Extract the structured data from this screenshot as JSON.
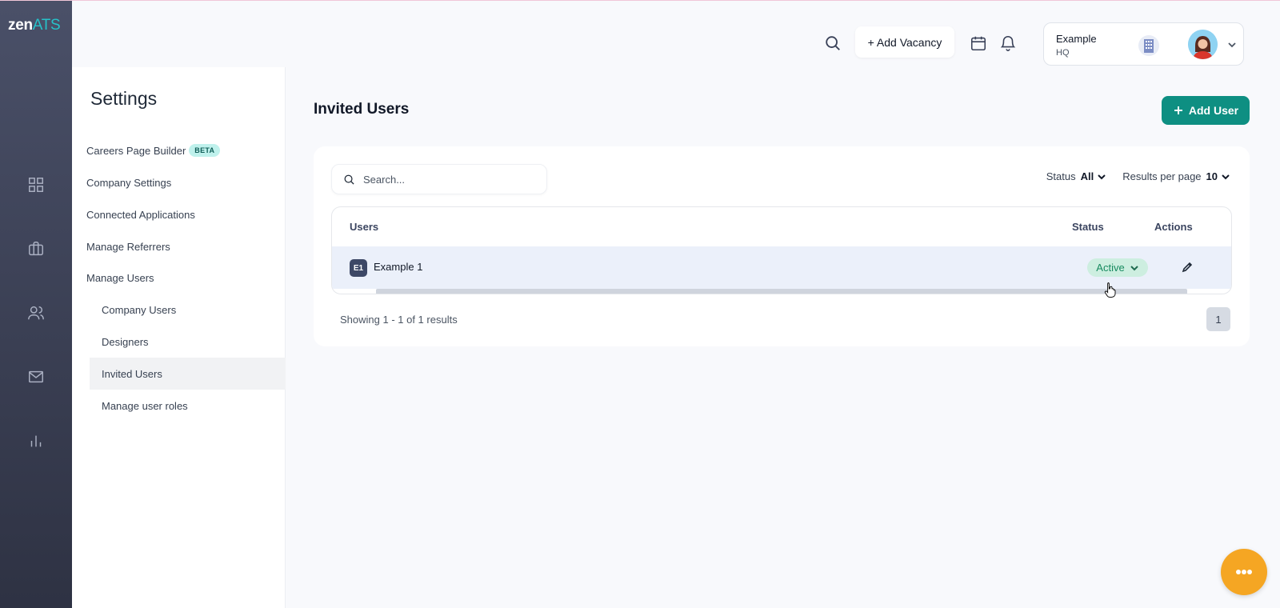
{
  "brand": {
    "logo_zen": "zen",
    "logo_ats": "ATS"
  },
  "rail": {
    "icons": [
      "dashboard-icon",
      "briefcase-icon",
      "people-icon",
      "mail-icon",
      "bar-chart-icon"
    ]
  },
  "topbar": {
    "add_vacancy_label": "+ Add Vacancy",
    "account": {
      "name": "Example",
      "sub": "HQ"
    }
  },
  "settings": {
    "title": "Settings",
    "nav": [
      {
        "label": "Careers Page Builder",
        "badge": "BETA"
      },
      {
        "label": "Company Settings"
      },
      {
        "label": "Connected Applications"
      },
      {
        "label": "Manage Referrers"
      },
      {
        "label": "Manage Users"
      }
    ],
    "subnav": [
      {
        "label": "Company Users"
      },
      {
        "label": "Designers"
      },
      {
        "label": "Invited Users",
        "active": true
      },
      {
        "label": "Manage user roles"
      }
    ]
  },
  "main": {
    "title": "Invited Users",
    "add_user_label": "Add User",
    "search_placeholder": "Search...",
    "filters": {
      "status_label": "Status",
      "status_value": "All",
      "per_page_label": "Results per page",
      "per_page_value": "10"
    },
    "table": {
      "headers": {
        "users": "Users",
        "status": "Status",
        "actions": "Actions"
      },
      "rows": [
        {
          "initials": "E1",
          "name": "Example 1",
          "status": "Active"
        }
      ]
    },
    "showing_text": "Showing 1 - 1 of 1 results",
    "current_page": "1"
  },
  "colors": {
    "accent": "#0e8f82",
    "status_active_bg": "#cdeee0",
    "fab": "#f5a623",
    "rail_top": "#4a5068"
  }
}
